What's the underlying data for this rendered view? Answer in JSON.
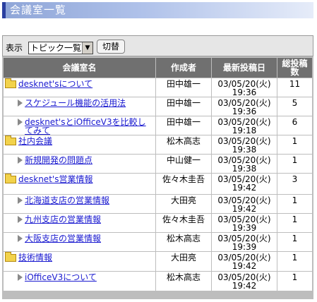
{
  "page": {
    "title": "会議室一覧"
  },
  "toolbar": {
    "display_label": "表示",
    "select_value": "トピック一覧",
    "switch_button": "切替"
  },
  "table": {
    "headers": [
      "会議室名",
      "作成者",
      "最新投稿日",
      "総投稿数"
    ],
    "rows": [
      {
        "level": "room",
        "name": "desknet'sについて",
        "author": "田中雄一",
        "date": "03/05/20(火)",
        "time": "19:36",
        "count": "11"
      },
      {
        "level": "sub",
        "name": "スケジュール機能の活用法",
        "author": "田中雄一",
        "date": "03/05/20(火)",
        "time": "19:36",
        "count": "5"
      },
      {
        "level": "sub",
        "name": "desknet'sとiOfficeV3を比較してみて",
        "author": "田中雄一",
        "date": "03/05/20(火)",
        "time": "19:18",
        "count": "6"
      },
      {
        "level": "room",
        "name": "社内会議",
        "author": "松木高志",
        "date": "03/05/20(火)",
        "time": "19:38",
        "count": "1"
      },
      {
        "level": "sub",
        "name": "新規開発の問題点",
        "author": "中山健一",
        "date": "03/05/20(火)",
        "time": "19:38",
        "count": "1"
      },
      {
        "level": "room",
        "name": "desknet's営業情報",
        "author": "佐々木圭吾",
        "date": "03/05/20(火)",
        "time": "19:42",
        "count": "3"
      },
      {
        "level": "sub",
        "name": "北海道支店の営業情報",
        "author": "大田亮",
        "date": "03/05/20(火)",
        "time": "19:42",
        "count": "1"
      },
      {
        "level": "sub",
        "name": "九州支店の営業情報",
        "author": "佐々木圭吾",
        "date": "03/05/20(火)",
        "time": "19:39",
        "count": "1"
      },
      {
        "level": "sub",
        "name": "大阪支店の営業情報",
        "author": "松木高志",
        "date": "03/05/20(火)",
        "time": "19:39",
        "count": "1"
      },
      {
        "level": "room",
        "name": "技術情報",
        "author": "大田亮",
        "date": "03/05/20(火)",
        "time": "19:42",
        "count": "1"
      },
      {
        "level": "sub",
        "name": "iOfficeV3について",
        "author": "松木高志",
        "date": "03/05/20(火)",
        "time": "19:42",
        "count": "1"
      }
    ]
  },
  "icons": {
    "room": "folder-icon",
    "sub": "arrow-right-icon"
  }
}
